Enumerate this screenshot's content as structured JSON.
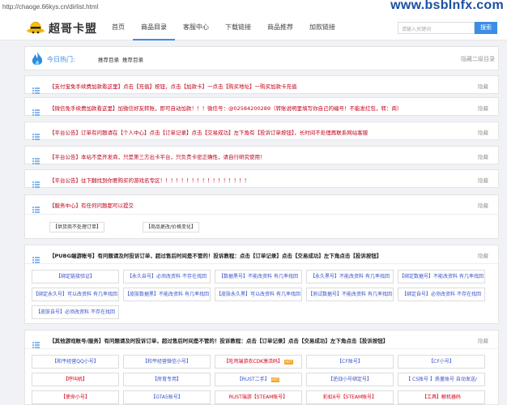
{
  "browser": {
    "url": "http://chaoge.66kys.cn/dirlist.html"
  },
  "watermark": "www.bsbInfx.com",
  "header": {
    "logo_text": "超哥卡盟",
    "nav": [
      "首页",
      "商品目录",
      "客服中心",
      "下载链接",
      "商品推荐",
      "加款链接"
    ],
    "active_nav": "商品目录",
    "search_placeholder": "请输入关键词",
    "search_button": "搜索"
  },
  "hotbar": {
    "label": "今日热门:",
    "items": [
      "推荐目录",
      "推荐目录"
    ],
    "hide_text": "隐藏二级目录"
  },
  "notices": [
    "【支付宝免手续费加款看这里】点击【充值】按钮，点击【加款卡】一点击【购买地址】一购买加款卡充值",
    "【微信免手续费加款看这里】加微信好友转账，即可自动加款！！！微信号：@02584200289（转账说明里填写你自己的编号！不能发红包，转：商）",
    "【平台公告】订单有问题请在【个人中心】点击【订单记录】点击【交易成功】左下角有【投诉订单按钮】，长时间不处理再联系网站客服",
    "【平台公告】本站不是开发商，只是第三方出卡平台，只负责卡密正确性，请自行研究使用！",
    "【平台公告】往下翻找到你要购买的游戏名专区！！！！！！！！！！！！！！！！！"
  ],
  "hide_label": "隐藏",
  "service": {
    "title": "【服务中心】有任何问题都可以提交",
    "tags": [
      "【供货商不处理订单】",
      "【商品更改/价格变化】"
    ]
  },
  "section1": {
    "title": "【PUBG端游账号】有问题请及时投诉订单，超过售后时间是不管的！投诉教程：点击【订单记录】点击【交易成功】左下角点击【投诉按钮】",
    "items": [
      {
        "name": "【绑定链接验证】",
        "desc": ""
      },
      {
        "name": "【永久自号】",
        "desc": "必须改资料 不存在找回"
      },
      {
        "name": "【数据黑号】",
        "desc": "不能改资料 有几率找回"
      },
      {
        "name": "【永久黑号】",
        "desc": "不能改资料 有几率找回"
      },
      {
        "name": "【绑定数据号】",
        "desc": "不能改资料 有几率找回"
      },
      {
        "name": "【绑定永久号】",
        "desc": "可以改资料 有几率找回"
      },
      {
        "name": "【皮肤数据黑】",
        "desc": "不能改资料 有几率找回"
      },
      {
        "name": "【皮肤永久黑】",
        "desc": "可以改资料 有几率找回"
      },
      {
        "name": "【测试数据号】",
        "desc": "不能改资料 有几率找回"
      },
      {
        "name": "【绑定自号】",
        "desc": "必须改资料 不存在找回"
      },
      {
        "name": "【皮肤自号】",
        "desc": "必须改资料 不存在找回"
      }
    ]
  },
  "section2": {
    "title": "【其他游戏账号/服务】有问题请及时投诉订单，超过售后时间是不管的！投诉教程：点击【订单记录】点击【交易成功】左下角点击【投诉按钮】",
    "hot_badge": "HOT",
    "items": [
      {
        "name": "【和平经营QQ小号】",
        "red": false,
        "hot": false
      },
      {
        "name": "【和平经营微信小号】",
        "red": false,
        "hot": false
      },
      {
        "name": "【吃鸡端游衣CDK激活码】",
        "red": true,
        "hot": true
      },
      {
        "name": "【CF账号】",
        "red": false,
        "hot": false
      },
      {
        "name": "【CF小号】",
        "red": false,
        "hot": false
      },
      {
        "name": "【呼叫机】",
        "red": true,
        "hot": false
      },
      {
        "name": "【房育专用】",
        "red": false,
        "hot": false
      },
      {
        "name": "【RUST二手】",
        "red": false,
        "hot": true
      },
      {
        "name": "【逆战小号绑定号】",
        "red": false,
        "hot": false
      },
      {
        "name": "【  CS账号  】质量账号 自动发送/",
        "red": false,
        "hot": false
      },
      {
        "name": "【使命小号】",
        "red": true,
        "hot": false
      },
      {
        "name": "【GTA5账号】",
        "red": false,
        "hot": false
      },
      {
        "name": "RUST端游【STEAM账号】",
        "red": true,
        "hot": false
      },
      {
        "name": "彩虹6号【STEAM账号】",
        "red": true,
        "hot": false
      },
      {
        "name": "【工具】解机器码",
        "red": true,
        "hot": false
      }
    ]
  },
  "colors": {
    "accent": "#3a8ee6",
    "notice_red": "#c0001a",
    "watermark": "#1b4fa0"
  }
}
